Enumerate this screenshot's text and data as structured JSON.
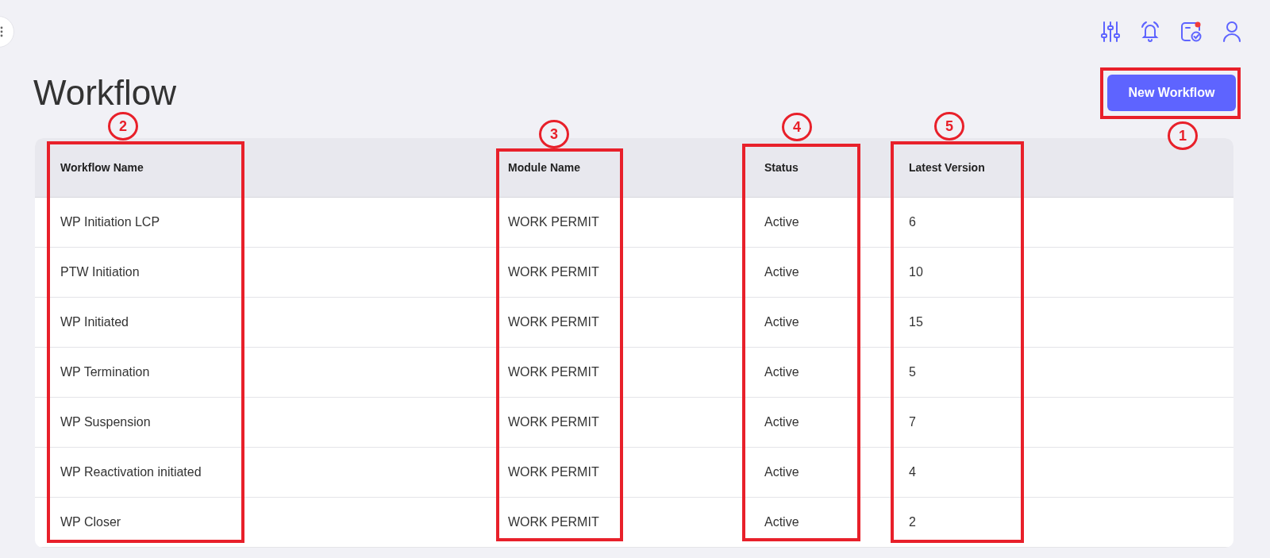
{
  "page": {
    "title": "Workflow"
  },
  "new_button": {
    "label": "New Workflow"
  },
  "toolbar": {
    "calendar_alert": true
  },
  "table": {
    "columns": [
      "Workflow Name",
      "Module Name",
      "Status",
      "Latest Version"
    ],
    "rows": [
      [
        "WP Initiation LCP",
        "WORK PERMIT",
        "Active",
        "6"
      ],
      [
        "PTW Initiation",
        "WORK PERMIT",
        "Active",
        "10"
      ],
      [
        "WP Initiated",
        "WORK PERMIT",
        "Active",
        "15"
      ],
      [
        "WP Termination",
        "WORK PERMIT",
        "Active",
        "5"
      ],
      [
        "WP Suspension",
        "WORK PERMIT",
        "Active",
        "7"
      ],
      [
        "WP Reactivation initiated",
        "WORK PERMIT",
        "Active",
        "4"
      ],
      [
        "WP Closer",
        "WORK PERMIT",
        "Active",
        "2"
      ]
    ]
  },
  "annotations": [
    {
      "number": "1"
    },
    {
      "number": "2"
    },
    {
      "number": "3"
    },
    {
      "number": "4"
    },
    {
      "number": "5"
    }
  ]
}
